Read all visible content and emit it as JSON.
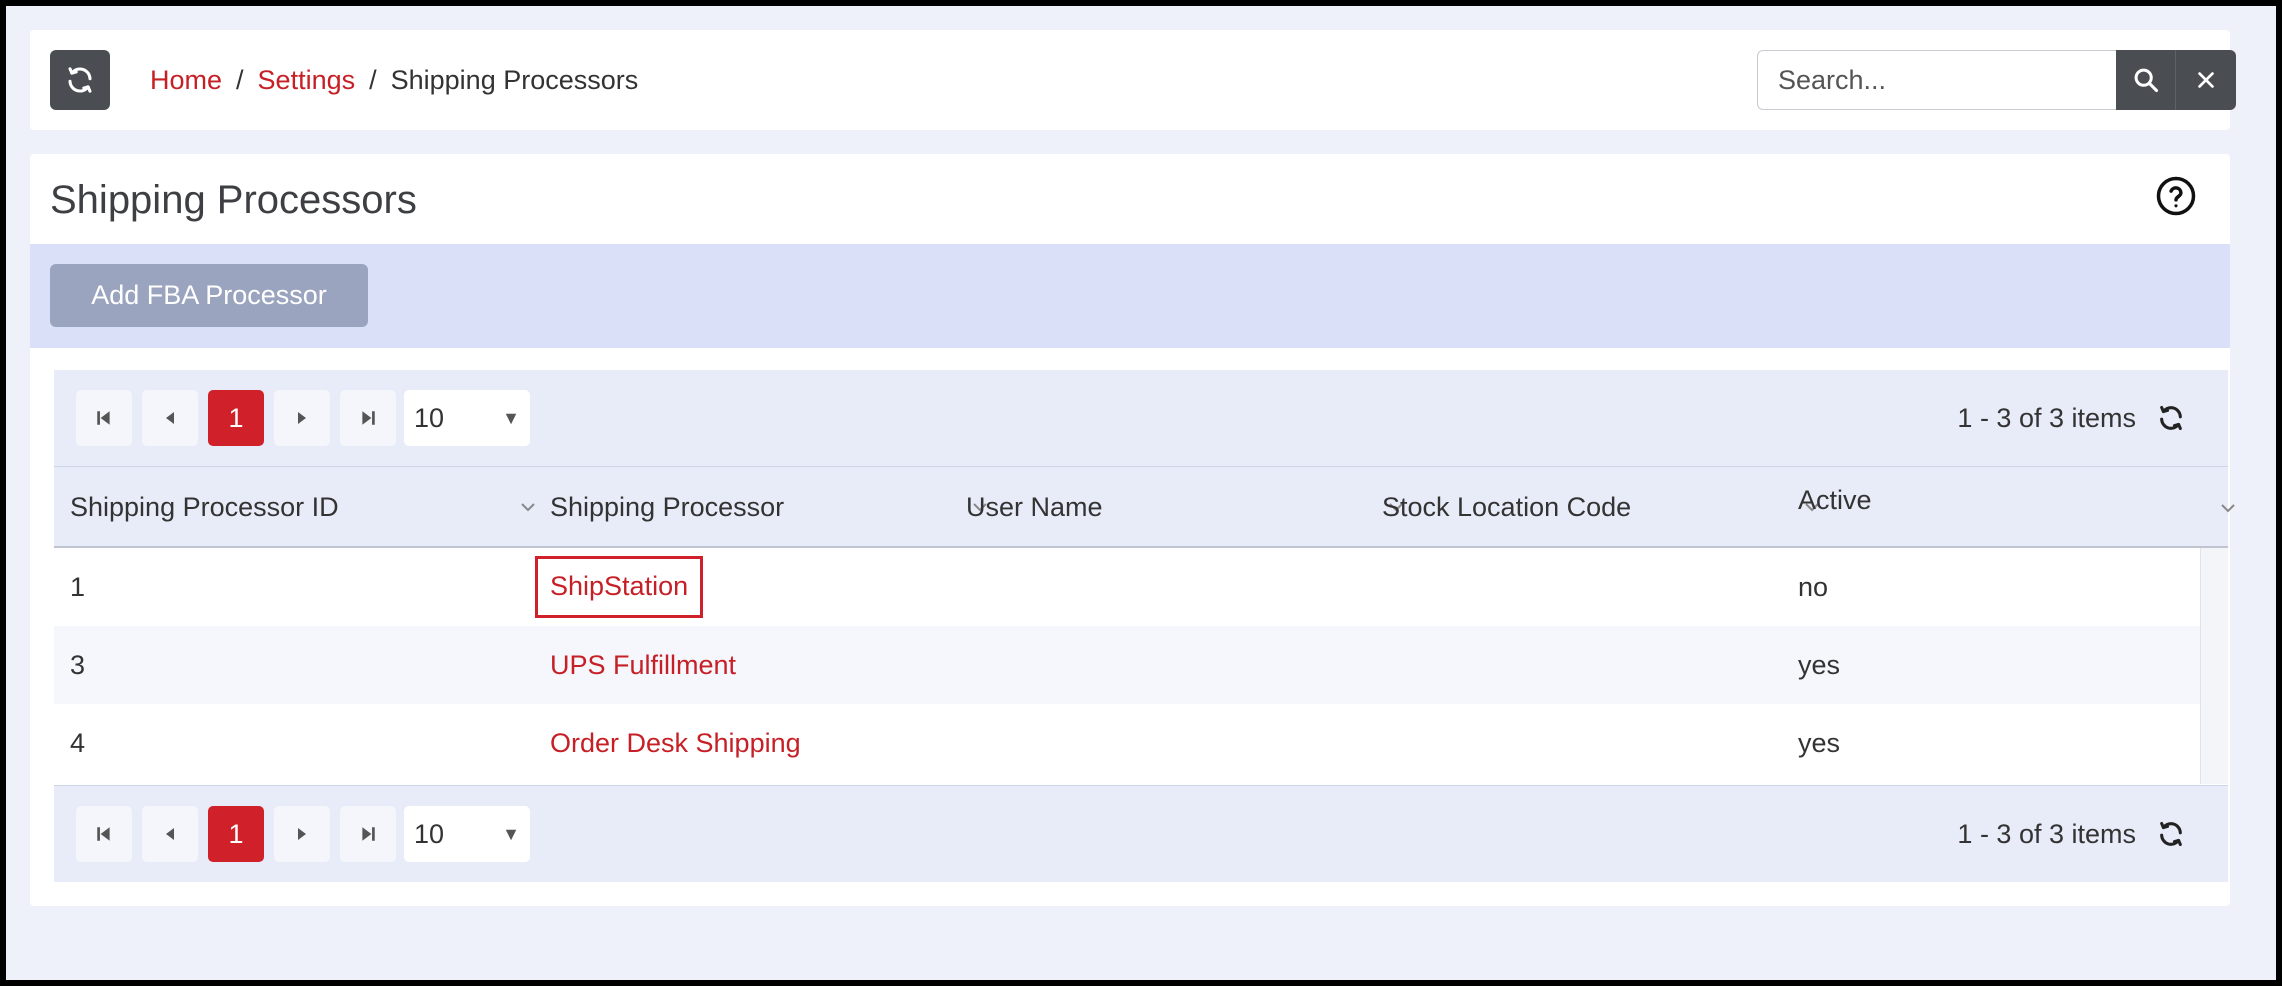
{
  "breadcrumb": {
    "home": "Home",
    "settings": "Settings",
    "current": "Shipping Processors",
    "separator": "/"
  },
  "search": {
    "placeholder": "Search..."
  },
  "page": {
    "title": "Shipping Processors",
    "add_button": "Add FBA Processor"
  },
  "pager": {
    "current_page": "1",
    "page_size": "10",
    "info": "1 - 3 of 3 items"
  },
  "table": {
    "columns": [
      "Shipping Processor ID",
      "Shipping Processor",
      "User Name",
      "Stock Location Code",
      "Active"
    ],
    "rows": [
      {
        "id": "1",
        "processor": "ShipStation",
        "user": "",
        "location": "",
        "active": "no"
      },
      {
        "id": "3",
        "processor": "UPS Fulfillment",
        "user": "",
        "location": "",
        "active": "yes"
      },
      {
        "id": "4",
        "processor": "Order Desk Shipping",
        "user": "",
        "location": "",
        "active": "yes"
      }
    ]
  },
  "colors": {
    "accent": "#c62026",
    "dark_button": "#4a4d52",
    "toolbar_bg": "#d9e0f7"
  },
  "icons": [
    "refresh-icon",
    "search-icon",
    "close-icon",
    "help-icon",
    "first-page-icon",
    "prev-page-icon",
    "next-page-icon",
    "last-page-icon",
    "chevron-down-icon"
  ]
}
